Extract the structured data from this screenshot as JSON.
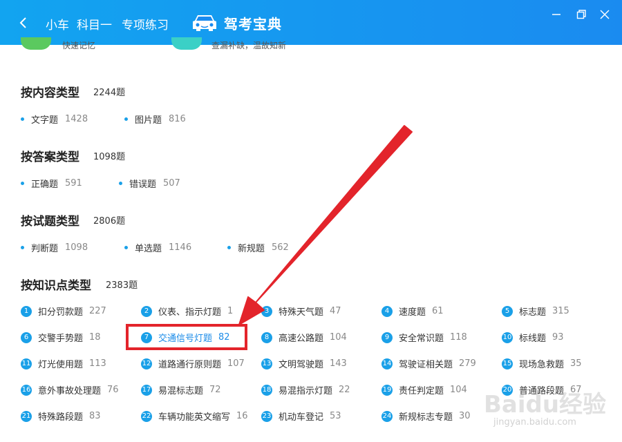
{
  "window": {
    "title_parts": [
      "小车",
      "科目一",
      "专项练习"
    ],
    "logo_text": "驾考宝典",
    "controls": [
      "minimize-icon",
      "maximize-icon",
      "close-icon"
    ]
  },
  "top_strip": {
    "left_text": "快速记忆",
    "right_text": "查漏补缺，温故知新"
  },
  "sections": {
    "content": {
      "title": "按内容类型",
      "count": "2244题",
      "items": [
        {
          "label": "文字题",
          "count": "1428"
        },
        {
          "label": "图片题",
          "count": "816"
        }
      ]
    },
    "answer": {
      "title": "按答案类型",
      "count": "1098题",
      "items": [
        {
          "label": "正确题",
          "count": "591"
        },
        {
          "label": "错误题",
          "count": "507"
        }
      ]
    },
    "question": {
      "title": "按试题类型",
      "count": "2806题",
      "items": [
        {
          "label": "判断题",
          "count": "1098"
        },
        {
          "label": "单选题",
          "count": "1146"
        },
        {
          "label": "新规题",
          "count": "562"
        }
      ]
    },
    "knowledge": {
      "title": "按知识点类型",
      "count": "2383题",
      "items": [
        {
          "num": "1",
          "label": "扣分罚款题",
          "count": "227"
        },
        {
          "num": "2",
          "label": "仪表、指示灯题",
          "count": "1"
        },
        {
          "num": "3",
          "label": "特殊天气题",
          "count": "47"
        },
        {
          "num": "4",
          "label": "速度题",
          "count": "61"
        },
        {
          "num": "5",
          "label": "标志题",
          "count": "315"
        },
        {
          "num": "6",
          "label": "交警手势题",
          "count": "18"
        },
        {
          "num": "7",
          "label": "交通信号灯题",
          "count": "82"
        },
        {
          "num": "8",
          "label": "高速公路题",
          "count": "104"
        },
        {
          "num": "9",
          "label": "安全常识题",
          "count": "118"
        },
        {
          "num": "10",
          "label": "标线题",
          "count": "93"
        },
        {
          "num": "11",
          "label": "灯光使用题",
          "count": "113"
        },
        {
          "num": "12",
          "label": "道路通行原则题",
          "count": "107"
        },
        {
          "num": "13",
          "label": "文明驾驶题",
          "count": "143"
        },
        {
          "num": "14",
          "label": "驾驶证相关题",
          "count": "279"
        },
        {
          "num": "15",
          "label": "现场急救题",
          "count": "35"
        },
        {
          "num": "16",
          "label": "意外事故处理题",
          "count": "76"
        },
        {
          "num": "17",
          "label": "易混标志题",
          "count": "72"
        },
        {
          "num": "18",
          "label": "易混指示灯题",
          "count": "22"
        },
        {
          "num": "19",
          "label": "责任判定题",
          "count": "104"
        },
        {
          "num": "20",
          "label": "普通路段题",
          "count": "67"
        },
        {
          "num": "21",
          "label": "特殊路段题",
          "count": "83"
        },
        {
          "num": "22",
          "label": "车辆功能英文缩写",
          "count": "16"
        },
        {
          "num": "23",
          "label": "机动车登记",
          "count": "53"
        },
        {
          "num": "24",
          "label": "新规标志专题",
          "count": "30"
        }
      ]
    }
  },
  "annotation": {
    "color": "#e3242b",
    "highlighted_item": "交通信号灯题"
  },
  "watermark": {
    "main": "Baidu经验",
    "sub": "jingyan.baidu.com"
  },
  "colors": {
    "header": "#1a8bf0",
    "accent": "#1aa0e8",
    "highlight_text": "#1a8be8"
  }
}
